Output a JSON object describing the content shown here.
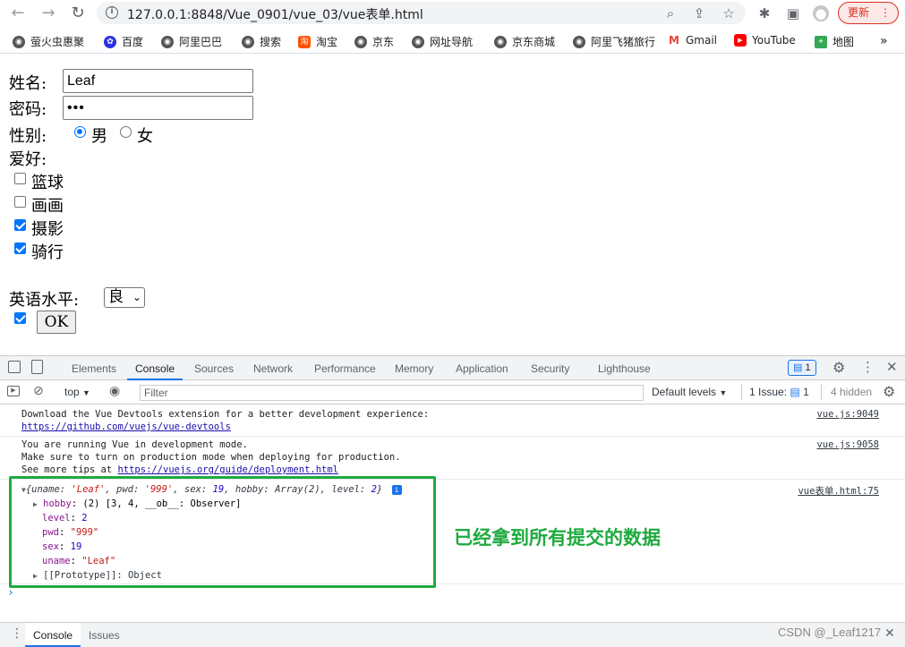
{
  "browser": {
    "url": "127.0.0.1:8848/Vue_0901/vue_03/vue表单.html",
    "update_label": "更新"
  },
  "bookmarks": [
    {
      "label": "萤火虫惠聚",
      "icon": "globe-icon",
      "color": "#555"
    },
    {
      "label": "百度",
      "icon": "baidu-icon",
      "color": "#2932e1"
    },
    {
      "label": "阿里巴巴",
      "icon": "globe-icon",
      "color": "#555"
    },
    {
      "label": "搜索",
      "icon": "globe-icon",
      "color": "#555"
    },
    {
      "label": "淘宝",
      "icon": "taobao-icon",
      "color": "#ff5000"
    },
    {
      "label": "京东",
      "icon": "globe-icon",
      "color": "#555"
    },
    {
      "label": "网址导航",
      "icon": "globe-icon",
      "color": "#555"
    },
    {
      "label": "京东商城",
      "icon": "globe-icon",
      "color": "#555"
    },
    {
      "label": "阿里飞猪旅行",
      "icon": "globe-icon",
      "color": "#555"
    },
    {
      "label": "Gmail",
      "icon": "gmail-icon",
      "color": "#ea4335"
    },
    {
      "label": "YouTube",
      "icon": "youtube-icon",
      "color": "#ff0000"
    },
    {
      "label": "地图",
      "icon": "maps-icon",
      "color": "#34a853"
    }
  ],
  "form": {
    "name_label": "姓名:",
    "name_value": "Leaf",
    "pwd_label": "密码:",
    "pwd_value": "•••",
    "sex_label": "性别:",
    "sex_male": "男",
    "sex_female": "女",
    "hobby_label": "爱好:",
    "hobbies": [
      {
        "label": "篮球",
        "checked": false
      },
      {
        "label": "画画",
        "checked": false
      },
      {
        "label": "摄影",
        "checked": true
      },
      {
        "label": "骑行",
        "checked": true
      }
    ],
    "level_label": "英语水平:",
    "level_value": "良",
    "ok_label": "OK"
  },
  "devtools": {
    "tabs": [
      "Elements",
      "Console",
      "Sources",
      "Network",
      "Performance",
      "Memory",
      "Application",
      "Security",
      "Lighthouse"
    ],
    "active_tab": "Console",
    "message_count": "1",
    "context": "top",
    "filter_placeholder": "Filter",
    "levels": "Default levels",
    "issues": "1 Issue:",
    "issues_count": "1",
    "hidden": "4 hidden",
    "messages": [
      {
        "line1": "Download the Vue Devtools extension for a better development experience:",
        "link": "https://github.com/vuejs/vue-devtools",
        "source": "vue.js:9049"
      },
      {
        "line1": "You are running Vue in development mode.",
        "line2": "Make sure to turn on production mode when deploying for production.",
        "line3_prefix": "See more tips at ",
        "link": "https://vuejs.org/guide/deployment.html",
        "source": "vue.js:9058"
      }
    ],
    "object_log": {
      "source": "vue表单.html:75",
      "summary_open": "{",
      "summary": [
        {
          "k": "uname",
          "v": "'Leaf'",
          "t": "str"
        },
        {
          "k": "pwd",
          "v": "'999'",
          "t": "str"
        },
        {
          "k": "sex",
          "v": "19",
          "t": "num"
        },
        {
          "k": "hobby",
          "v": "Array(2)",
          "t": "plain"
        },
        {
          "k": "level",
          "v": "2",
          "t": "num"
        }
      ],
      "hobby_key": "hobby",
      "hobby_val": "(2) [3, 4, __ob__: Observer]",
      "level_key": "level",
      "level_val": "2",
      "pwd_key": "pwd",
      "pwd_val": "\"999\"",
      "sex_key": "sex",
      "sex_val": "19",
      "uname_key": "uname",
      "uname_val": "\"Leaf\"",
      "proto": "[[Prototype]]: Object"
    },
    "drawer_tabs": [
      "Console",
      "Issues"
    ]
  },
  "annotation": "已经拿到所有提交的数据",
  "watermark": "CSDN @_Leaf1217",
  "colors": {
    "annotation_green": "#1faa3f",
    "accent_blue": "#1a73e8"
  }
}
